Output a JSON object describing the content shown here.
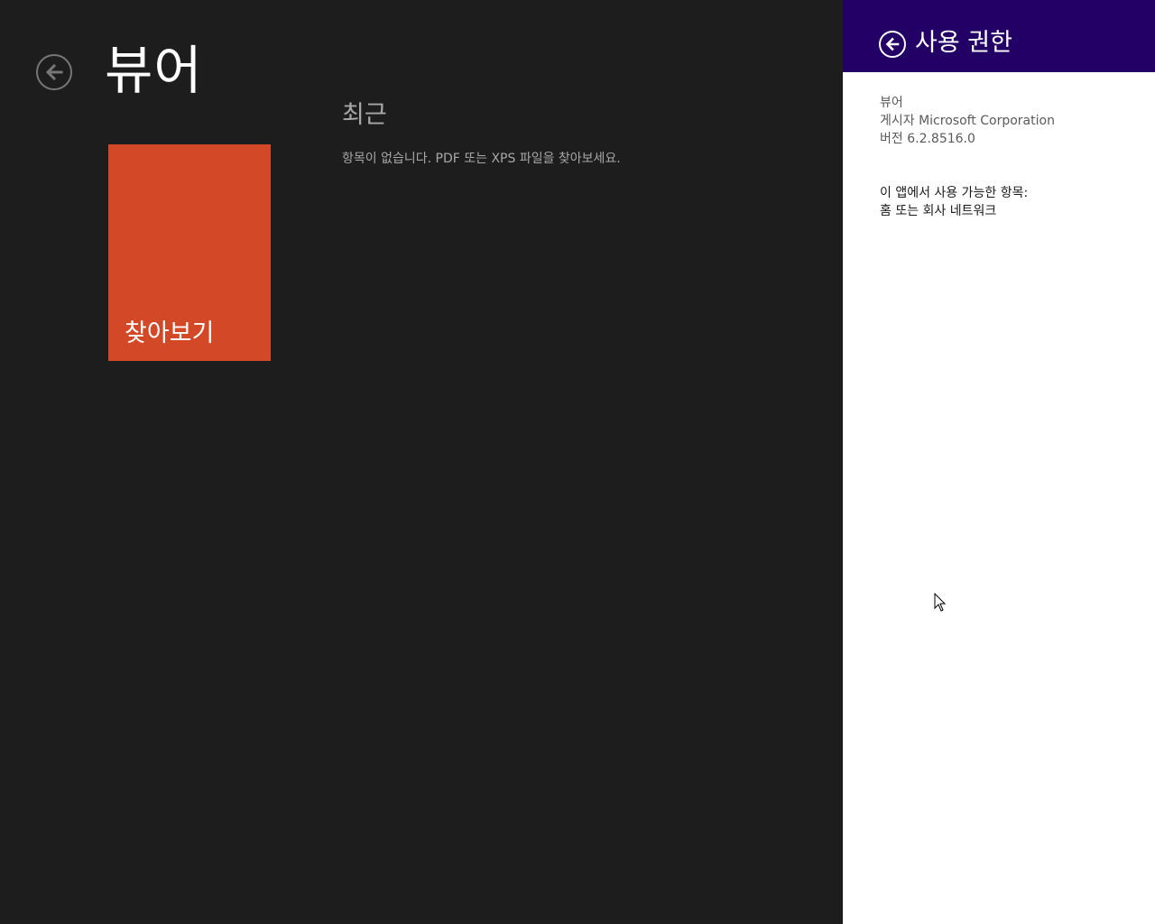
{
  "app": {
    "title": "뷰어",
    "recent": {
      "header": "최근",
      "empty_message": "항목이 없습니다. PDF 또는 XPS 파일을 찾아보세요."
    },
    "browse_tile": {
      "label": "찾아보기",
      "color": "#d34826"
    },
    "background": "#1d1d1d"
  },
  "flyout": {
    "title": "사용 권한",
    "header_color": "#230066",
    "app_name": "뷰어",
    "publisher": "게시자 Microsoft Corporation",
    "version": "버전 6.2.8516.0",
    "capabilities_label": "이 앱에서 사용 가능한 항목:",
    "capabilities": [
      "홈 또는 회사 네트워크"
    ]
  },
  "icons": {
    "back": "arrow-left-circle-icon",
    "flyout_back": "arrow-left-circle-icon",
    "cursor": "mouse-pointer-icon"
  }
}
